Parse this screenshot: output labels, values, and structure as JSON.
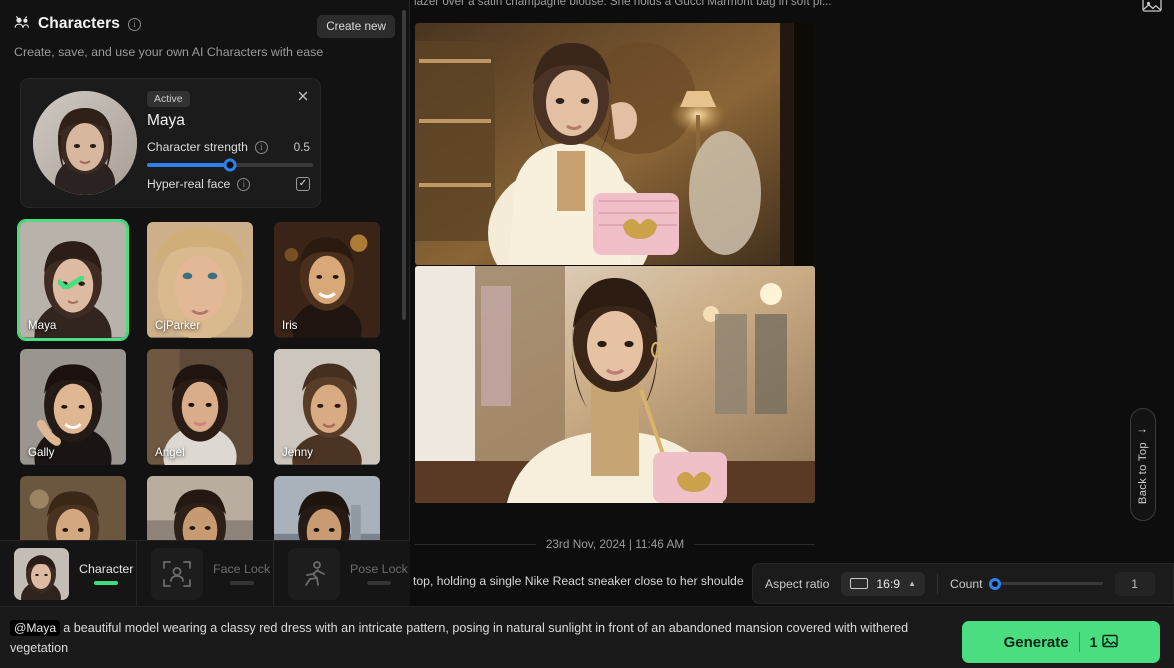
{
  "sidebar": {
    "icon": "people-group-icon",
    "title": "Characters",
    "subtitle": "Create, save, and use your own AI Characters with ease",
    "create_new_label": "Create new",
    "active_card": {
      "badge": "Active",
      "name": "Maya",
      "strength_label": "Character strength",
      "strength_value": "0.5",
      "strength_percent": 50,
      "hyper_real_label": "Hyper-real face",
      "hyper_real_checked": true,
      "check_glyph": "✓",
      "close_icon": "close-icon"
    },
    "characters": [
      {
        "name": "Maya",
        "selected": true
      },
      {
        "name": "CjParker",
        "selected": false
      },
      {
        "name": "Iris",
        "selected": false
      },
      {
        "name": "Gally",
        "selected": false
      },
      {
        "name": "Angel",
        "selected": false
      },
      {
        "name": "Jenny",
        "selected": false
      },
      {
        "name": "",
        "selected": false
      },
      {
        "name": "",
        "selected": false
      },
      {
        "name": "",
        "selected": false
      }
    ]
  },
  "lock_bar": {
    "tabs": [
      {
        "label": "Character",
        "icon": "character-thumbnail",
        "active": true
      },
      {
        "label": "Face Lock",
        "icon": "face-lock-icon",
        "active": false
      },
      {
        "label": "Pose Lock",
        "icon": "pose-lock-icon",
        "active": false
      }
    ]
  },
  "main": {
    "clipped_caption": "lazer over a satin champagne blouse. She holds a Gucci Marmont bag in soft pi...",
    "top_right_icon": "image-gallery-icon",
    "timestamp": "23rd Nov, 2024 | 11:46 AM",
    "next_caption": "top, holding a single Nike React sneaker close to her shoulde",
    "back_to_top": {
      "label": "Back to Top",
      "arrow": "↑"
    },
    "images": [
      {
        "alt": "Woman in cream blazer holding pink Gucci Marmont bag in warm boutique"
      },
      {
        "alt": "Woman in cream blazer with pink chain bag in bright boutique"
      }
    ]
  },
  "options_bar": {
    "aspect_ratio_label": "Aspect ratio",
    "aspect_ratio_value": "16:9",
    "aspect_ratio_icon": "rectangle-16-9-icon",
    "caret_icon": "caret-up-icon",
    "count_label": "Count",
    "count_value": "1",
    "count_percent": 0
  },
  "prompt_bar": {
    "mention": "@Maya",
    "text": "a beautiful model wearing a classy red dress with an intricate pattern, posing in natural sunlight in front of an abandoned mansion covered with withered vegetation",
    "generate_label": "Generate",
    "generate_count": "1",
    "generate_icon": "image-icon"
  },
  "colors": {
    "accent_green": "#4ade80",
    "accent_blue": "#2f80ed",
    "panel_bg": "#121212",
    "page_bg": "#0d0d0d"
  }
}
